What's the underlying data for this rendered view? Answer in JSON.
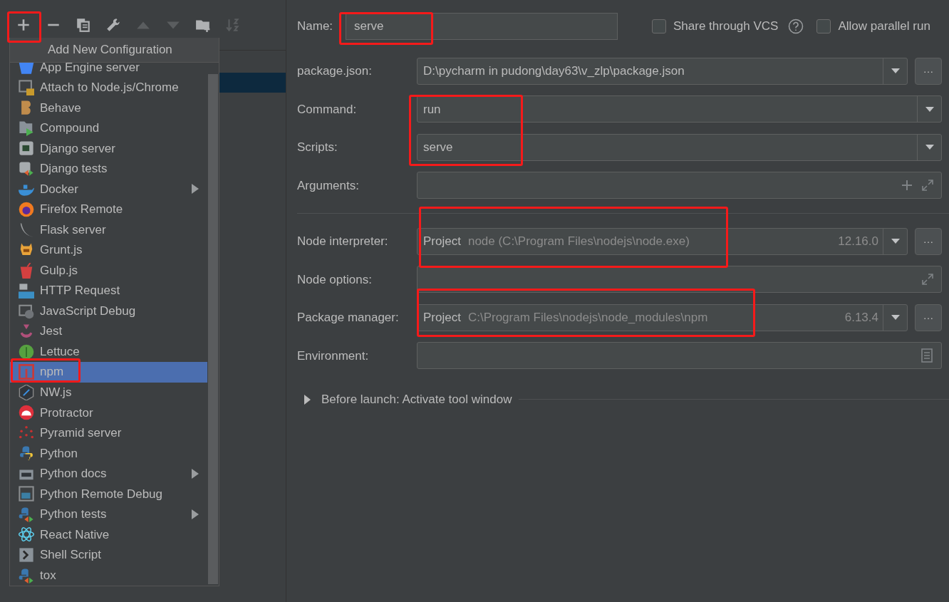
{
  "toolbar": {
    "buttons": [
      {
        "kind": "add",
        "disabled": false
      },
      {
        "kind": "remove",
        "disabled": false
      },
      {
        "kind": "copy",
        "disabled": false
      },
      {
        "kind": "edit",
        "disabled": false
      },
      {
        "kind": "up",
        "disabled": true
      },
      {
        "kind": "down",
        "disabled": true
      },
      {
        "kind": "folder",
        "disabled": false
      },
      {
        "kind": "sort",
        "disabled": true
      }
    ],
    "tooltip": "Add New Configuration"
  },
  "add_menu": {
    "items": [
      {
        "label": "App Engine server",
        "selected": false,
        "submenu": false
      },
      {
        "label": "Attach to Node.js/Chrome",
        "selected": false,
        "submenu": false
      },
      {
        "label": "Behave",
        "selected": false,
        "submenu": false
      },
      {
        "label": "Compound",
        "selected": false,
        "submenu": false
      },
      {
        "label": "Django server",
        "selected": false,
        "submenu": false
      },
      {
        "label": "Django tests",
        "selected": false,
        "submenu": false
      },
      {
        "label": "Docker",
        "selected": false,
        "submenu": true
      },
      {
        "label": "Firefox Remote",
        "selected": false,
        "submenu": false
      },
      {
        "label": "Flask server",
        "selected": false,
        "submenu": false
      },
      {
        "label": "Grunt.js",
        "selected": false,
        "submenu": false
      },
      {
        "label": "Gulp.js",
        "selected": false,
        "submenu": false
      },
      {
        "label": "HTTP Request",
        "selected": false,
        "submenu": false
      },
      {
        "label": "JavaScript Debug",
        "selected": false,
        "submenu": false
      },
      {
        "label": "Jest",
        "selected": false,
        "submenu": false
      },
      {
        "label": "Lettuce",
        "selected": false,
        "submenu": false
      },
      {
        "label": "npm",
        "selected": true,
        "submenu": false
      },
      {
        "label": "NW.js",
        "selected": false,
        "submenu": false
      },
      {
        "label": "Protractor",
        "selected": false,
        "submenu": false
      },
      {
        "label": "Pyramid server",
        "selected": false,
        "submenu": false
      },
      {
        "label": "Python",
        "selected": false,
        "submenu": false
      },
      {
        "label": "Python docs",
        "selected": false,
        "submenu": true
      },
      {
        "label": "Python Remote Debug",
        "selected": false,
        "submenu": false
      },
      {
        "label": "Python tests",
        "selected": false,
        "submenu": true
      },
      {
        "label": "React Native",
        "selected": false,
        "submenu": false
      },
      {
        "label": "Shell Script",
        "selected": false,
        "submenu": false
      },
      {
        "label": "tox",
        "selected": false,
        "submenu": false
      }
    ]
  },
  "form": {
    "name": {
      "label": "Name:",
      "value": "serve"
    },
    "share_vcs": {
      "label": "Share through VCS",
      "checked": false
    },
    "allow_parallel": {
      "label": "Allow parallel run",
      "checked": false
    },
    "rows": [
      {
        "kind": "combo",
        "label": "package.json:",
        "value": "D:\\pycharm in pudong\\day63\\v_zlp\\package.json",
        "browse_label": "…"
      },
      {
        "kind": "combo",
        "label": "Command:",
        "value": "run"
      },
      {
        "kind": "combo",
        "label": "Scripts:",
        "value": "serve"
      },
      {
        "kind": "args",
        "label": "Arguments:"
      }
    ],
    "node_rows": [
      {
        "kind": "interpreter",
        "label": "Node interpreter:",
        "prefix": "Project",
        "value": "node (C:\\Program Files\\nodejs\\node.exe)",
        "version": "12.16.0",
        "browse_label": "…"
      },
      {
        "kind": "options",
        "label": "Node options:"
      },
      {
        "kind": "interpreter",
        "label": "Package manager:",
        "prefix": "Project",
        "value": "C:\\Program Files\\nodejs\\node_modules\\npm",
        "version": "6.13.4",
        "browse_label": "…"
      },
      {
        "kind": "env",
        "label": "Environment:"
      }
    ]
  },
  "before_launch": {
    "label": "Before launch: Activate tool window",
    "expanded": false
  }
}
